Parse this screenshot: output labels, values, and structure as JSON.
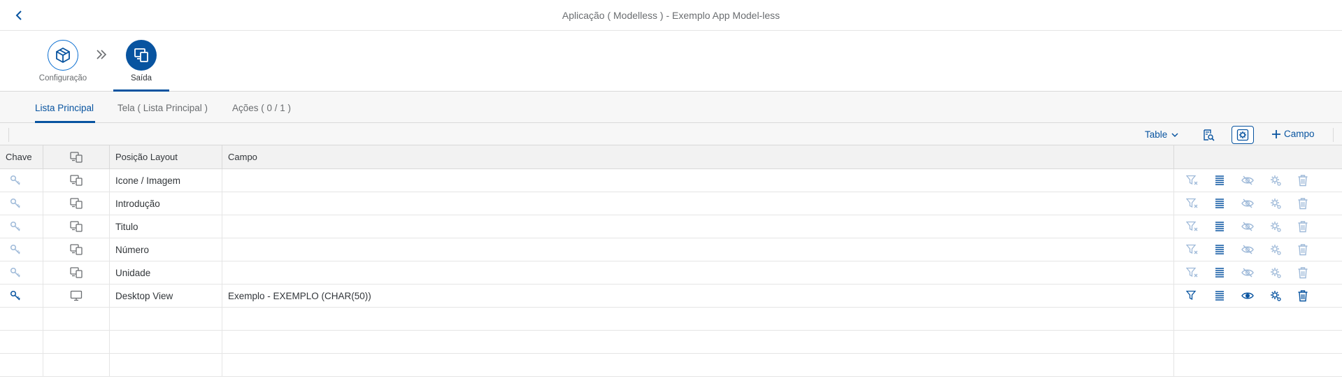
{
  "header": {
    "title": "Aplicação ( Modelless ) - Exemplo App Model-less",
    "back_icon": "navigation-left-arrow-icon"
  },
  "wizard": {
    "steps": [
      {
        "label": "Configuração",
        "icon": "product-box-icon",
        "active": false
      },
      {
        "label": "Saída",
        "icon": "multi-device-icon",
        "active": true
      }
    ],
    "separator_icon": "double-chevron-right-icon"
  },
  "tabs": [
    {
      "label": "Lista Principal",
      "active": true
    },
    {
      "label": "Tela ( Lista Principal )",
      "active": false
    },
    {
      "label": "Ações ( 0 / 1 )",
      "active": false
    }
  ],
  "toolbar": {
    "view_select": "Table",
    "preview_icon": "document-search-icon",
    "settings_icon": "settings-gears-icon",
    "add_label": "Campo"
  },
  "table": {
    "columns": [
      "Chave",
      "",
      "Posição Layout",
      "Campo",
      ""
    ],
    "rows": [
      {
        "key_active": false,
        "device": "multi-device",
        "layout": "Icone / Imagem",
        "field": "",
        "enabled": false
      },
      {
        "key_active": false,
        "device": "multi-device",
        "layout": "Introdução",
        "field": "",
        "enabled": false
      },
      {
        "key_active": false,
        "device": "multi-device",
        "layout": "Titulo",
        "field": "",
        "enabled": false
      },
      {
        "key_active": false,
        "device": "multi-device",
        "layout": "Número",
        "field": "",
        "enabled": false
      },
      {
        "key_active": false,
        "device": "multi-device",
        "layout": "Unidade",
        "field": "",
        "enabled": false
      },
      {
        "key_active": true,
        "device": "desktop",
        "layout": "Desktop View",
        "field": "Exemplo - EXEMPLO (CHAR(50))",
        "enabled": true
      }
    ],
    "empty_rows": 3,
    "row_actions": [
      "filter-icon",
      "list-icon",
      "visibility-icon",
      "settings-icon",
      "delete-icon"
    ]
  },
  "colors": {
    "accent": "#0854a0",
    "accent_light": "#0a6ed1",
    "disabled_icon": "#9fbad9",
    "text": "#32363a",
    "muted": "#6a6d70"
  }
}
